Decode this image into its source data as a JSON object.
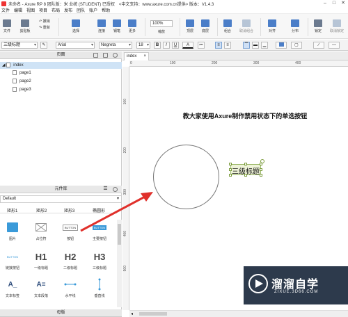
{
  "titlebar": {
    "title": "未命名 - Axure RP 8 团队版：米 业统 (STUDENT) 已授权　<中文支持：www.axure.com.cn提供> 版本：V1.4.3",
    "min": "–",
    "max": "□",
    "close": "✕"
  },
  "menu": [
    "文件",
    "编辑",
    "视图",
    "项目",
    "布局",
    "发布",
    "团队",
    "账户",
    "帮助"
  ],
  "toolbar": {
    "file": "文件",
    "clipboard": "剪贴板",
    "undo": "撤销",
    "redo": "重做",
    "select": "选择",
    "connect": "连接",
    "pen": "钢笔",
    "more": "更多",
    "zoom_value": "100%",
    "zoom": "缩放",
    "top": "顶层",
    "bottom": "底层",
    "group": "组合",
    "ungroup": "取消组合",
    "align": "对齐",
    "distribute": "分布",
    "lock": "锁定",
    "unlock": "取消锁定"
  },
  "format": {
    "style": "三级标题",
    "font": "Arial",
    "weight": "Negreta",
    "size": "18",
    "bold": "B",
    "italic": "I",
    "underline": "U",
    "color": "A"
  },
  "pages": {
    "title": "页面",
    "root": "index",
    "items": [
      "page1",
      "page2",
      "page3"
    ]
  },
  "library": {
    "title": "元件库",
    "selected": "Default",
    "row0": [
      "矩形1",
      "矩形2",
      "矩形3",
      "椭圆形"
    ],
    "widgets": [
      {
        "label": "图片",
        "icon": "image-icon"
      },
      {
        "label": "占位符",
        "icon": "placeholder-icon"
      },
      {
        "label": "按钮",
        "icon": "button-icon",
        "glyph": "BUTTON"
      },
      {
        "label": "主要按钮",
        "icon": "primary-button-icon",
        "glyph": "BUTTON"
      },
      {
        "label": "链接按钮",
        "icon": "link-button-icon",
        "glyph": "BUTTON"
      },
      {
        "label": "一级标题",
        "icon": "h1-icon",
        "glyph": "H1"
      },
      {
        "label": "二级标题",
        "icon": "h2-icon",
        "glyph": "H2"
      },
      {
        "label": "三级标题",
        "icon": "h3-icon",
        "glyph": "H3"
      },
      {
        "label": "文本标签",
        "icon": "text-label-icon",
        "glyph": "A_"
      },
      {
        "label": "文本段落",
        "icon": "paragraph-icon",
        "glyph": "A≡"
      },
      {
        "label": "水平线",
        "icon": "horizontal-line-icon"
      },
      {
        "label": "垂直线",
        "icon": "vertical-line-icon"
      }
    ],
    "footer": "母版"
  },
  "canvas": {
    "tab": "index",
    "ruler_h": [
      "0",
      "100",
      "200",
      "300",
      "400"
    ],
    "ruler_v": [
      "100",
      "200",
      "300",
      "400",
      "500"
    ],
    "heading": "教大家使用Axure制作禁用状态下的单选按钮",
    "label": "三级标题"
  },
  "watermark": {
    "brand": "溜溜自学",
    "url": "ZIXUE.3D66.COM"
  },
  "colors": {
    "accent": "#4b7ec8",
    "selection": "#9cb86a",
    "arrow": "#e0302b"
  }
}
